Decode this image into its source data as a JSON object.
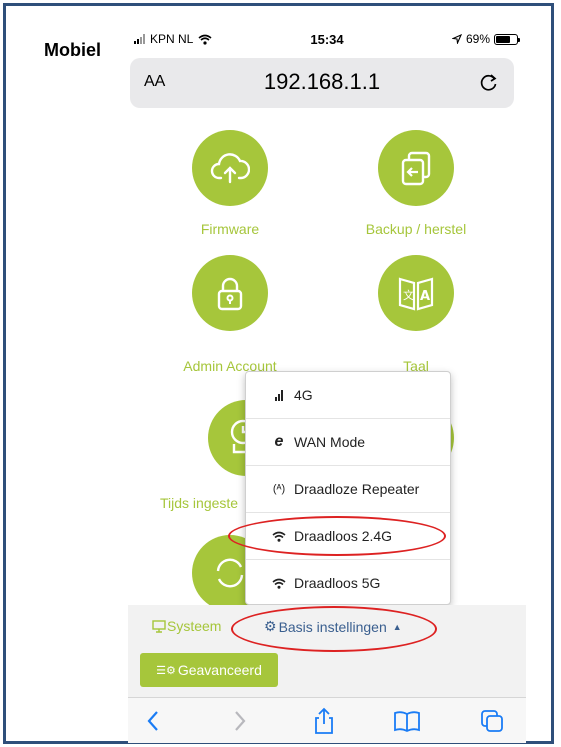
{
  "frame": {
    "label": "Mobiel"
  },
  "status_bar": {
    "carrier": "KPN NL",
    "time": "15:34",
    "battery_percent": "69%",
    "battery_level": 0.69
  },
  "address_bar": {
    "text_size_label": "AA",
    "url": "192.168.1.1"
  },
  "tiles": [
    {
      "label": "Firmware",
      "icon": "cloud-upload-icon"
    },
    {
      "label": "Backup / herstel",
      "icon": "backup-restore-icon"
    },
    {
      "label": "Admin Account",
      "icon": "lock-icon"
    },
    {
      "label": "Taal",
      "icon": "language-book-icon"
    },
    {
      "label": "Tijds ingeste",
      "icon": "clock-icon"
    },
    {
      "label": "",
      "icon": "refresh-icon"
    }
  ],
  "dropdown": {
    "items": [
      {
        "label": "4G",
        "icon": "signal-bars-icon"
      },
      {
        "label": "WAN Mode",
        "icon": "internet-explorer-icon"
      },
      {
        "label": "Draadloze Repeater",
        "icon": "antenna-icon"
      },
      {
        "label": "Draadloos 2.4G",
        "icon": "wifi-icon"
      },
      {
        "label": "Draadloos 5G",
        "icon": "wifi-icon"
      }
    ]
  },
  "bottom_nav": {
    "systeem_label": "Systeem",
    "basis_label": "Basis instellingen",
    "geavanceerd_label": "Geavanceerd"
  },
  "colors": {
    "accent": "#a6c63b",
    "link": "#3a5f8f",
    "highlight": "#d22222",
    "ios_blue": "#1a7cf5"
  }
}
